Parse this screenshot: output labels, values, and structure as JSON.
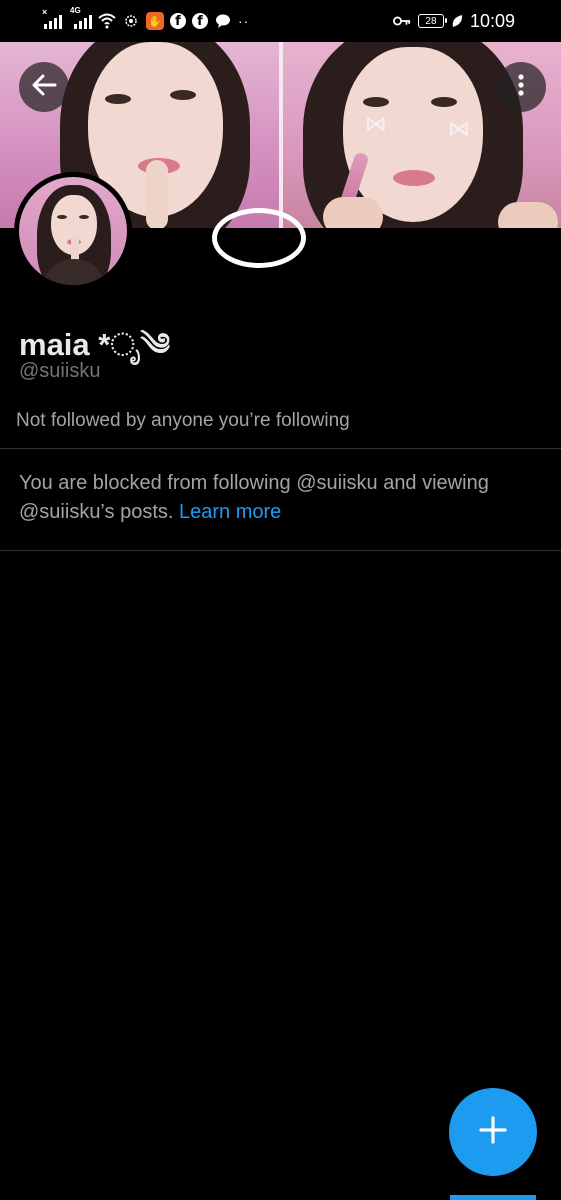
{
  "status_bar": {
    "network_label": "4G",
    "battery_level": "28",
    "time": "10:09",
    "icons": [
      "signal-no-sim-icon",
      "signal-4g-icon",
      "wifi-icon",
      "settings-gear-icon",
      "app-notification-icon",
      "facebook-icon",
      "facebook-icon",
      "chat-bubble-icon",
      "more-dots-icon",
      "vpn-key-icon",
      "battery-icon",
      "battery-saver-leaf-icon"
    ]
  },
  "header": {
    "back_icon": "arrow-left-icon",
    "more_icon": "vertical-dots-icon"
  },
  "profile": {
    "display_name": "maia *ೃ༄",
    "handle": "@suiisku",
    "followed_by": "Not followed by anyone you’re following",
    "blocked_text": "You are blocked from following @suiisku and viewing @suiisku’s posts.",
    "learn_more": "Learn more"
  },
  "fab": {
    "icon": "plus-icon"
  },
  "colors": {
    "background": "#000000",
    "accent": "#1d9bf0",
    "primary_text": "#e7e9ea",
    "secondary_text": "#71767b",
    "divider": "#2f3336"
  }
}
